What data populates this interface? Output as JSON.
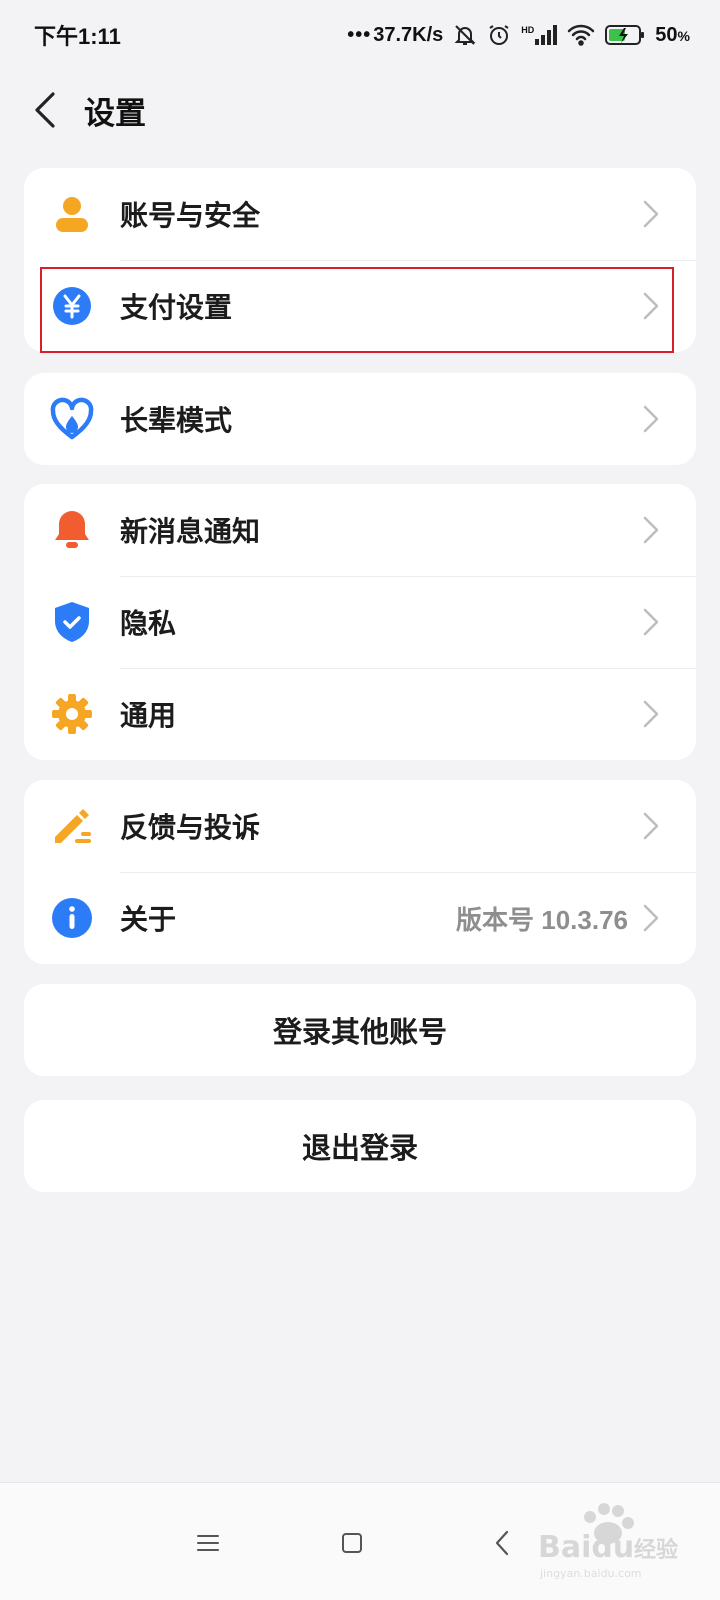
{
  "status_bar": {
    "time": "下午1:11",
    "network_speed": "37.7K/s",
    "battery": "50",
    "battery_unit": "%",
    "signal_type": "HD"
  },
  "header": {
    "title": "设置",
    "back_icon": "chevron-left-icon"
  },
  "groups": [
    {
      "items": [
        {
          "label": "账号与安全",
          "icon": "user-icon",
          "icon_color": "#f5a623"
        },
        {
          "label": "支付设置",
          "icon": "yuan-icon",
          "icon_color": "#2b7cf6"
        }
      ]
    },
    {
      "items": [
        {
          "label": "长辈模式",
          "icon": "heart-care-icon",
          "icon_color": "#2b7cf6"
        }
      ]
    },
    {
      "items": [
        {
          "label": "新消息通知",
          "icon": "bell-icon",
          "icon_color": "#f25d30"
        },
        {
          "label": "隐私",
          "icon": "shield-check-icon",
          "icon_color": "#2b7cf6"
        },
        {
          "label": "通用",
          "icon": "gear-icon",
          "icon_color": "#f5a623"
        }
      ]
    },
    {
      "items": [
        {
          "label": "反馈与投诉",
          "icon": "edit-pen-icon",
          "icon_color": "#f5a623"
        },
        {
          "label": "关于",
          "icon": "info-icon",
          "icon_color": "#2b7cf6",
          "value": "版本号 10.3.76"
        }
      ]
    }
  ],
  "actions": {
    "switch_account": "登录其他账号",
    "logout": "退出登录"
  },
  "colors": {
    "highlight": "#d8202a",
    "background": "#f3f3f5"
  }
}
